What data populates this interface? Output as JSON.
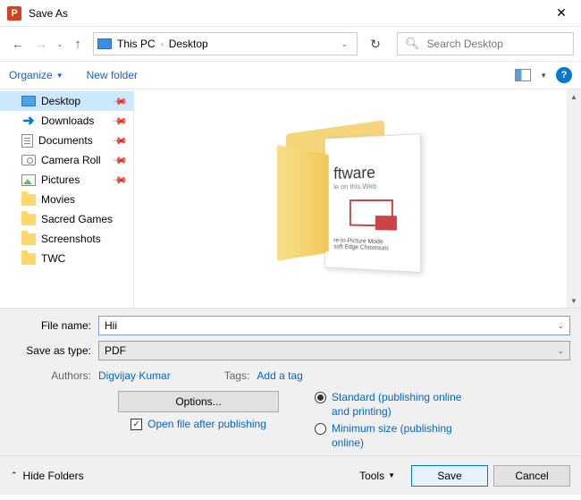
{
  "titlebar": {
    "title": "Save As"
  },
  "breadcrumb": {
    "pc": "This PC",
    "location": "Desktop"
  },
  "search": {
    "placeholder": "Search Desktop"
  },
  "toolbar": {
    "organize": "Organize",
    "newfolder": "New folder"
  },
  "sidebar": {
    "items": [
      {
        "label": "Desktop",
        "icon": "desktop",
        "pinned": true,
        "selected": true
      },
      {
        "label": "Downloads",
        "icon": "download",
        "pinned": true
      },
      {
        "label": "Documents",
        "icon": "doc",
        "pinned": true
      },
      {
        "label": "Camera Roll",
        "icon": "cam",
        "pinned": true
      },
      {
        "label": "Pictures",
        "icon": "pic",
        "pinned": true
      },
      {
        "label": "Movies",
        "icon": "folder"
      },
      {
        "label": "Sacred Games",
        "icon": "folder"
      },
      {
        "label": "Screenshots",
        "icon": "folder"
      },
      {
        "label": "TWC",
        "icon": "folder"
      }
    ]
  },
  "preview": {
    "text1": "ftware",
    "text2": "le on this Web",
    "text3": "re-In-Picture Mode",
    "text4": "soft Edge Chromium"
  },
  "fields": {
    "filename_label": "File name:",
    "filename_value": "Hii",
    "savetype_label": "Save as type:",
    "savetype_value": "PDF"
  },
  "meta": {
    "authors_label": "Authors:",
    "authors_value": "Digvijay Kumar",
    "tags_label": "Tags:",
    "tags_value": "Add a tag"
  },
  "options": {
    "button": "Options...",
    "openafter": "Open file after publishing",
    "radio1": "Standard (publishing online and printing)",
    "radio2": "Minimum size (publishing online)"
  },
  "footer": {
    "hidefolders": "Hide Folders",
    "tools": "Tools",
    "save": "Save",
    "cancel": "Cancel"
  }
}
